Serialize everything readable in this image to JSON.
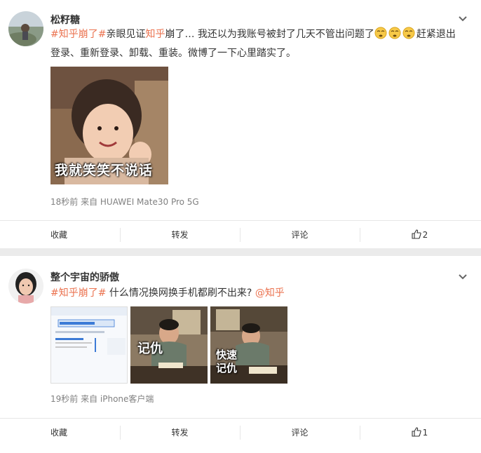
{
  "posts": [
    {
      "username": "松籽糖",
      "text": {
        "tag1": "#知乎崩了#",
        "part1": "亲眼见证",
        "mention": "知乎",
        "part2": "崩了… 我还以为我账号被封了几天不管出问题了",
        "part3": "赶紧退出",
        "line2": "登录、重新登录、卸载、重装。微博了一下心里踏实了。"
      },
      "image_caption": "我就笑笑不说话",
      "meta": "18秒前  来自 HUAWEI Mate30 Pro 5G",
      "actions": {
        "collect": "收藏",
        "repost": "转发",
        "comment": "评论",
        "like_count": "2"
      }
    },
    {
      "username": "整个宇宙的骄傲",
      "text": {
        "tag1": "#知乎崩了#",
        "part1": " 什么情况换网换手机都刷不出来? ",
        "mention": "@知乎"
      },
      "image_captions": [
        "记仇",
        "快速",
        "记仇"
      ],
      "meta": "19秒前  来自 iPhone客户端",
      "actions": {
        "collect": "收藏",
        "repost": "转发",
        "comment": "评论",
        "like_count": "1"
      }
    }
  ],
  "colors": {
    "highlight": "#eb7350",
    "meta": "#808080",
    "background": "#ebebeb"
  }
}
